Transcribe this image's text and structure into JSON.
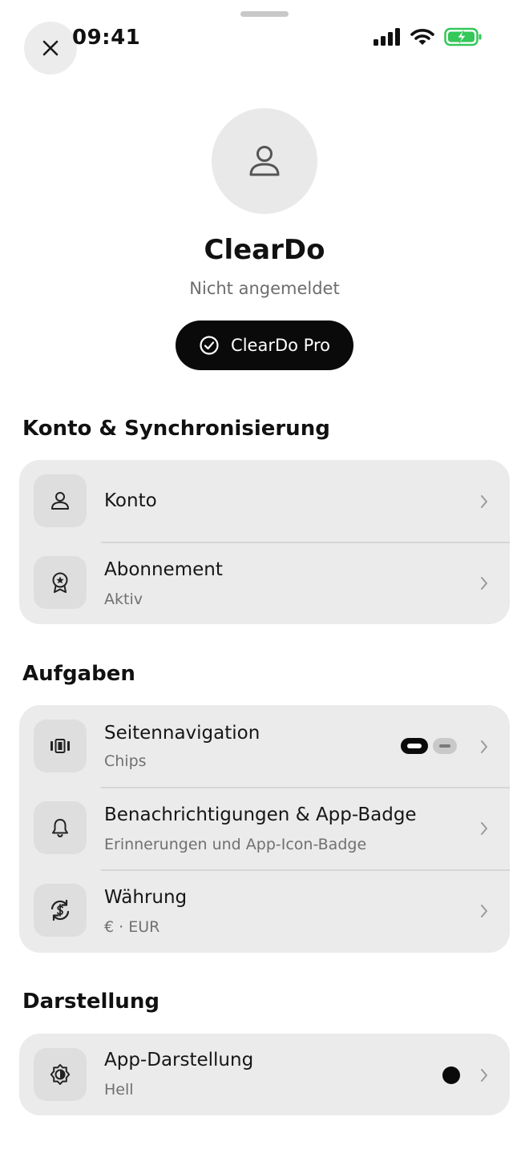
{
  "status_bar": {
    "time": "09:41"
  },
  "profile": {
    "app_name": "ClearDo",
    "login_status": "Nicht angemeldet",
    "pro_button_label": "ClearDo Pro"
  },
  "sections": {
    "account": {
      "title": "Konto & Synchronisierung",
      "items": [
        {
          "title": "Konto",
          "icon": "person-icon"
        },
        {
          "title": "Abonnement",
          "subtitle": "Aktiv",
          "icon": "award-badge-icon"
        }
      ]
    },
    "tasks": {
      "title": "Aufgaben",
      "items": [
        {
          "title": "Seitennavigation",
          "subtitle": "Chips",
          "icon": "carousel-icon"
        },
        {
          "title": "Benachrichtigungen & App-Badge",
          "subtitle": "Erinnerungen und App-Icon-Badge",
          "icon": "bell-icon"
        },
        {
          "title": "Währung",
          "subtitle": "€ · EUR",
          "icon": "currency-exchange-icon"
        }
      ]
    },
    "appearance": {
      "title": "Darstellung",
      "items": [
        {
          "title": "App-Darstellung",
          "subtitle": "Hell",
          "icon": "brightness-icon"
        }
      ]
    }
  },
  "colors": {
    "background": "#ffffff",
    "card": "#ebebeb",
    "icon_tile": "#dedede",
    "primary": "#0a0a0a",
    "battery": "#34c759"
  }
}
